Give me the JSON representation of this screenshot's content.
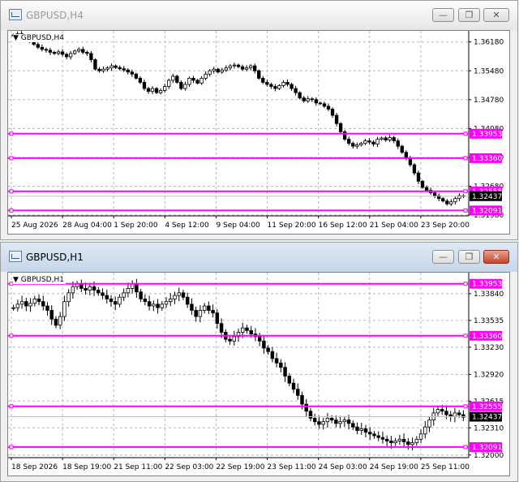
{
  "accent": "#ff00ff",
  "windows": [
    {
      "title": "GBPUSD,H4",
      "symbol_label": "GBPUSD,H4",
      "price_min": 1.3196,
      "price_max": 1.3645,
      "price_ticks": [
        "1.36180",
        "1.35480",
        "1.34780",
        "1.34080",
        "1.33380",
        "1.32680",
        "1.31980"
      ],
      "time_labels": [
        "25 Aug 2026",
        "28 Aug 04:00",
        "1 Sep 20:00",
        "4 Sep 12:00",
        "9 Sep 04:00",
        "11 Sep 20:00",
        "16 Sep 12:00",
        "21 Sep 04:00",
        "23 Sep 20:00"
      ],
      "levels": [
        {
          "price": 1.33953,
          "label": "1.33953"
        },
        {
          "price": 1.3336,
          "label": "1.33360"
        },
        {
          "price": 1.32555,
          "label": "1.32555"
        },
        {
          "price": 1.32091,
          "label": "1.32091"
        }
      ],
      "current": {
        "price": 1.32437,
        "label": "1.32437"
      },
      "closes": [
        1.3635,
        1.3638,
        1.3632,
        1.3628,
        1.3622,
        1.3612,
        1.3605,
        1.36,
        1.3598,
        1.3593,
        1.359,
        1.3594,
        1.3588,
        1.3582,
        1.359,
        1.3596,
        1.36,
        1.3593,
        1.359,
        1.3575,
        1.3552,
        1.3548,
        1.3552,
        1.3555,
        1.356,
        1.3556,
        1.3553,
        1.355,
        1.3545,
        1.354,
        1.353,
        1.352,
        1.3505,
        1.3498,
        1.3505,
        1.3495,
        1.35,
        1.351,
        1.3525,
        1.3535,
        1.352,
        1.3505,
        1.3515,
        1.353,
        1.3525,
        1.3518,
        1.353,
        1.354,
        1.3548,
        1.3552,
        1.3545,
        1.355,
        1.3555,
        1.356,
        1.3562,
        1.3558,
        1.3552,
        1.3555,
        1.356,
        1.3548,
        1.353,
        1.352,
        1.3515,
        1.351,
        1.3505,
        1.3512,
        1.352,
        1.3515,
        1.3505,
        1.3495,
        1.3482,
        1.3475,
        1.348,
        1.3478,
        1.347,
        1.3468,
        1.3462,
        1.3455,
        1.344,
        1.342,
        1.34,
        1.3382,
        1.3372,
        1.3365,
        1.3368,
        1.3372,
        1.3378,
        1.3375,
        1.337,
        1.3382,
        1.3385,
        1.338,
        1.3386,
        1.3378,
        1.3365,
        1.335,
        1.3335,
        1.332,
        1.33,
        1.328,
        1.3265,
        1.3258,
        1.3252,
        1.3245,
        1.3238,
        1.3232,
        1.3225,
        1.323,
        1.3238,
        1.3245,
        1.3243
      ]
    },
    {
      "title": "GBPUSD,H1",
      "symbol_label": "GBPUSD,H1",
      "price_min": 1.3197,
      "price_max": 1.3408,
      "price_ticks": [
        "1.33840",
        "1.33535",
        "1.33230",
        "1.32920",
        "1.32615",
        "1.32310",
        "1.32000"
      ],
      "time_labels": [
        "18 Sep 2026",
        "18 Sep 19:00",
        "21 Sep 11:00",
        "22 Sep 03:00",
        "22 Sep 19:00",
        "23 Sep 11:00",
        "24 Sep 03:00",
        "24 Sep 19:00",
        "25 Sep 11:00"
      ],
      "levels": [
        {
          "price": 1.33953,
          "label": "1.33953"
        },
        {
          "price": 1.3336,
          "label": "1.33360"
        },
        {
          "price": 1.32555,
          "label": "1.32555"
        },
        {
          "price": 1.32091,
          "label": "1.32091"
        }
      ],
      "current": {
        "price": 1.32437,
        "label": "1.32437"
      },
      "closes": [
        1.3368,
        1.3372,
        1.3375,
        1.337,
        1.3373,
        1.3378,
        1.3375,
        1.337,
        1.3365,
        1.3355,
        1.3348,
        1.3358,
        1.3375,
        1.3385,
        1.3392,
        1.3395,
        1.339,
        1.3388,
        1.3392,
        1.3388,
        1.3385,
        1.3382,
        1.3378,
        1.3375,
        1.3372,
        1.338,
        1.3385,
        1.339,
        1.3395,
        1.3386,
        1.3378,
        1.3375,
        1.337,
        1.3372,
        1.3368,
        1.3372,
        1.3375,
        1.3378,
        1.3382,
        1.3385,
        1.338,
        1.3372,
        1.3365,
        1.3358,
        1.3365,
        1.337,
        1.3365,
        1.3362,
        1.335,
        1.334,
        1.3332,
        1.333,
        1.3335,
        1.334,
        1.3345,
        1.3342,
        1.3338,
        1.3335,
        1.333,
        1.3322,
        1.3318,
        1.331,
        1.3305,
        1.33,
        1.329,
        1.3282,
        1.3275,
        1.3268,
        1.3258,
        1.325,
        1.3242,
        1.3238,
        1.3235,
        1.3238,
        1.3242,
        1.324,
        1.3236,
        1.3238,
        1.324,
        1.3236,
        1.3232,
        1.3228,
        1.323,
        1.3226,
        1.3224,
        1.3222,
        1.322,
        1.3218,
        1.3216,
        1.3214,
        1.3216,
        1.3218,
        1.3215,
        1.3212,
        1.3214,
        1.3218,
        1.3224,
        1.3232,
        1.324,
        1.3248,
        1.3252,
        1.325,
        1.3246,
        1.3244,
        1.3248,
        1.3246,
        1.3243
      ]
    }
  ]
}
